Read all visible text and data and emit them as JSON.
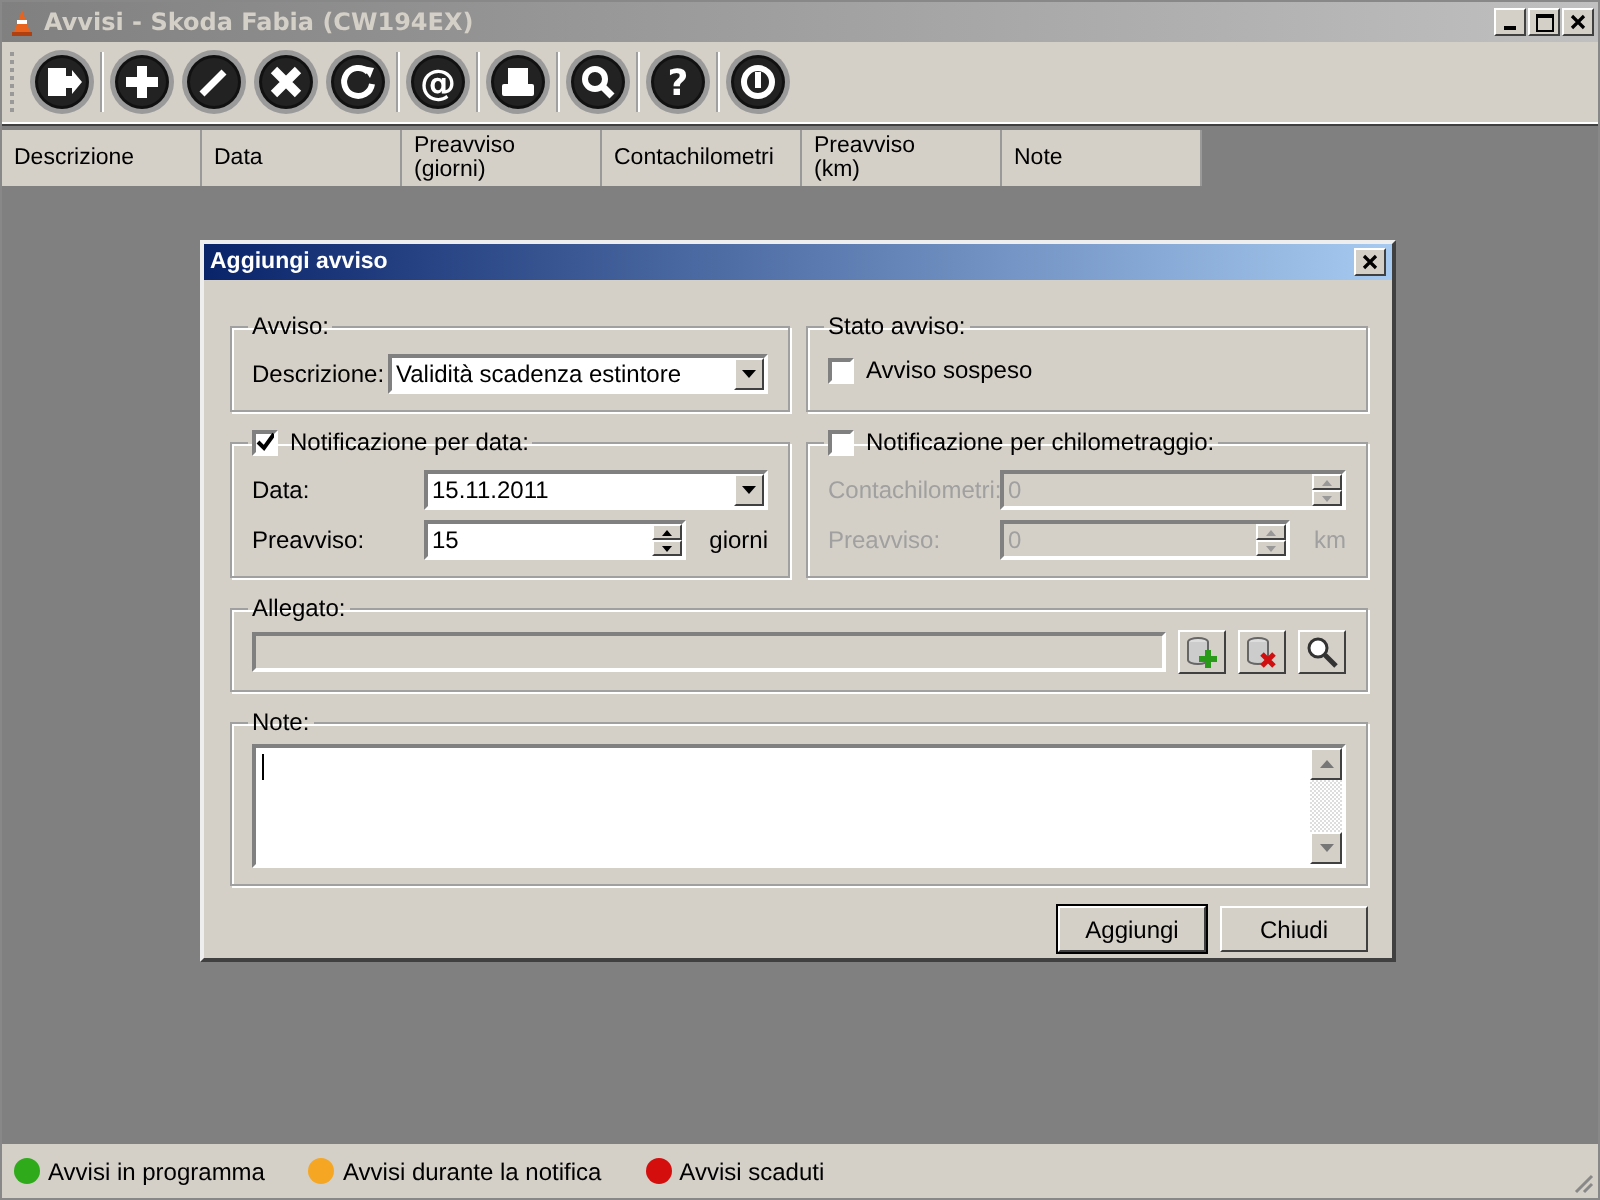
{
  "window": {
    "title": "Avvisi - Skoda Fabia (CW194EX)"
  },
  "toolbar": [
    {
      "kind": "exit"
    },
    {
      "kind": "add"
    },
    {
      "kind": "edit"
    },
    {
      "kind": "delete"
    },
    {
      "kind": "refresh"
    },
    {
      "kind": "email",
      "label": "@"
    },
    {
      "kind": "print"
    },
    {
      "kind": "search"
    },
    {
      "kind": "help",
      "label": "?"
    },
    {
      "kind": "power"
    }
  ],
  "table": {
    "columns": [
      "Descrizione",
      "Data",
      "Preavviso\n(giorni)",
      "Contachilometri",
      "Preavviso\n(km)",
      "Note"
    ]
  },
  "dialog": {
    "title": "Aggiungi avviso",
    "avviso_group": {
      "legend": "Avviso:",
      "label": "Descrizione:",
      "value": "Validità scadenza estintore"
    },
    "stato_group": {
      "legend": "Stato avviso:",
      "checkbox": {
        "label": "Avviso sospeso",
        "checked": false
      }
    },
    "groups": [
      {
        "legend": "Notificazione per data:",
        "checked": true,
        "fields": [
          {
            "label": "Data:",
            "value": "15.11.2011",
            "kind": "dropdown"
          },
          {
            "label": "Preavviso:",
            "value": "15",
            "kind": "spinner",
            "unit": "giorni"
          }
        ]
      },
      {
        "legend": "Notificazione per chilometraggio:",
        "checked": false,
        "fields": [
          {
            "label": "Contachilometri:",
            "value": "0",
            "kind": "spinner"
          },
          {
            "label": "Preavviso:",
            "value": "0",
            "kind": "spinner",
            "unit": "km"
          }
        ]
      }
    ],
    "allegato": {
      "legend": "Allegato:",
      "buttons": [
        {
          "kind": "add"
        },
        {
          "kind": "remove"
        },
        {
          "kind": "view"
        }
      ]
    },
    "note": {
      "legend": "Note:"
    },
    "buttons": [
      {
        "label": "Aggiungi",
        "default": true
      },
      {
        "label": "Chiudi",
        "default": false
      }
    ]
  },
  "status_bar": [
    {
      "label": "Avvisi in programma",
      "color": "#2eaa1a"
    },
    {
      "label": "Avvisi durante la notifica",
      "color": "#f5a623"
    },
    {
      "label": "Avvisi scaduti",
      "color": "#d40d0d"
    }
  ]
}
